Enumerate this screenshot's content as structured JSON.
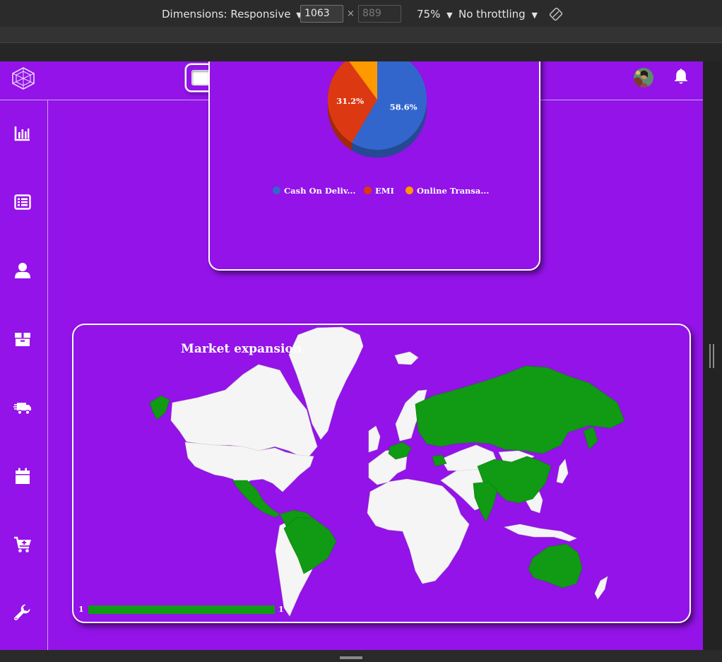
{
  "devtools": {
    "dimensions_label": "Dimensions: Responsive",
    "width_value": "1063",
    "times_sign": "×",
    "height_placeholder": "889",
    "zoom": "75%",
    "throttling": "No throttling",
    "dropdown_arrow": "▼"
  },
  "topbar": {
    "search": {
      "value": "",
      "placeholder": ""
    },
    "icons": [
      "logo-icon",
      "search-icon",
      "avatar",
      "bell-icon"
    ]
  },
  "sidebar": {
    "items": [
      {
        "icon": "bar-chart-icon"
      },
      {
        "icon": "list-icon"
      },
      {
        "icon": "user-icon"
      },
      {
        "icon": "box-icon"
      },
      {
        "icon": "truck-icon"
      },
      {
        "icon": "calendar-icon"
      },
      {
        "icon": "cart-plus-icon"
      },
      {
        "icon": "wrench-icon"
      }
    ]
  },
  "payment_chart": {
    "chart_data": {
      "type": "pie",
      "categories": [
        "Cash On Deliv...",
        "EMI",
        "Online Transa..."
      ],
      "values": [
        58.6,
        31.2,
        10.2
      ],
      "slice_labels": [
        "58.6%",
        "31.2%",
        ""
      ],
      "colors": [
        "#3366cc",
        "#dc3912",
        "#ff9900"
      ],
      "legend_position": "bottom"
    }
  },
  "market_map": {
    "title": "Market expansion",
    "scale_min_label": "1",
    "scale_max_label": "1",
    "highlight_color": "#119a14",
    "base_color": "#f5f5f5",
    "highlighted_regions": [
      "Mexico",
      "Central America",
      "Brazil",
      "Colombia",
      "Venezuela",
      "Russia",
      "China",
      "India",
      "Australia",
      "Ukraine",
      "Poland",
      "Alaska"
    ]
  },
  "colors": {
    "app_background": "#9313e8",
    "card_border": "#ffffff"
  }
}
